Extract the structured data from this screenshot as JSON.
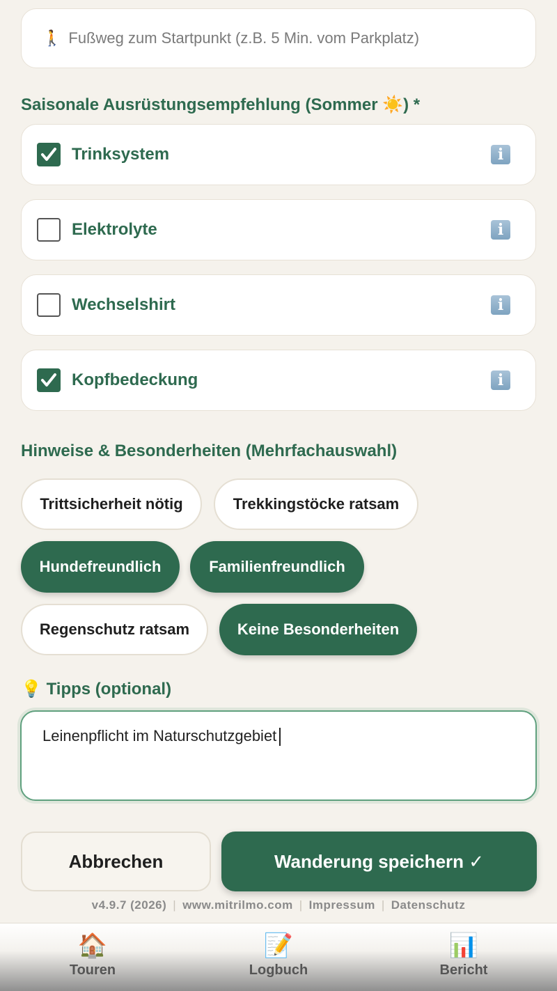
{
  "walk_field": {
    "icon": "🚶",
    "placeholder": "Fußweg zum Startpunkt (z.B. 5 Min. vom Parkplatz)"
  },
  "gear": {
    "heading": "Saisonale Ausrüstungsempfehlung (Sommer ☀️) *",
    "items": [
      {
        "label": "Trinksystem",
        "checked": true,
        "info_icon": "ℹ️"
      },
      {
        "label": "Elektrolyte",
        "checked": false,
        "info_icon": "ℹ️"
      },
      {
        "label": "Wechselshirt",
        "checked": false,
        "info_icon": "ℹ️"
      },
      {
        "label": "Kopfbedeckung",
        "checked": true,
        "info_icon": "ℹ️"
      }
    ]
  },
  "hints": {
    "heading": "Hinweise & Besonderheiten (Mehrfachauswahl)",
    "chips": [
      {
        "label": "Trittsicherheit nötig",
        "selected": false
      },
      {
        "label": "Trekkingstöcke ratsam",
        "selected": false
      },
      {
        "label": "Hundefreundlich",
        "selected": true
      },
      {
        "label": "Familienfreundlich",
        "selected": true
      },
      {
        "label": "Regenschutz ratsam",
        "selected": false
      },
      {
        "label": "Keine Besonderheiten",
        "selected": true
      }
    ]
  },
  "tips": {
    "icon": "💡",
    "heading": "Tipps (optional)",
    "value": "Leinenpflicht im Naturschutzgebiet"
  },
  "actions": {
    "cancel": "Abbrechen",
    "save": "Wanderung speichern ✓"
  },
  "footer": {
    "version": "v4.9.7 (2026)",
    "website": "www.mitrilmo.com",
    "imprint": "Impressum",
    "privacy": "Datenschutz"
  },
  "tabbar": {
    "tabs": [
      {
        "icon": "🏠",
        "label": "Touren"
      },
      {
        "icon": "📝",
        "label": "Logbuch"
      },
      {
        "icon": "📊",
        "label": "Bericht"
      }
    ]
  },
  "colors": {
    "accent": "#2e6a4f",
    "background": "#f5f2ec"
  }
}
